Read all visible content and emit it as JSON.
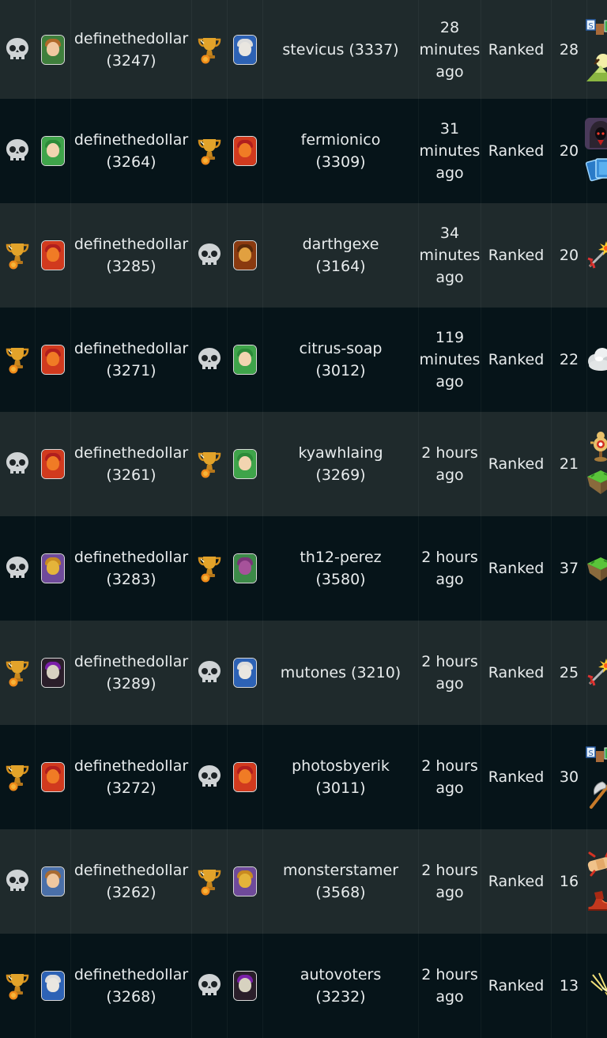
{
  "colors": {
    "row_light": "#1f2a2c",
    "row_dark": "#061419",
    "text": "#e8eced",
    "trophy_gold": "#e2a32a"
  },
  "battles": [
    {
      "player": {
        "result_icon": "skull-icon",
        "avatar": "avatar-young-man-green",
        "name": "definethedollar",
        "rating": "(3247)"
      },
      "opponent": {
        "result_icon": "trophy-icon",
        "avatar": "avatar-wizard-blue",
        "name": "stevicus (3337)",
        "rating": ""
      },
      "time": {
        "amount": "28",
        "unit": "minutes",
        "suffix": "ago"
      },
      "match_type": "Ranked",
      "mana": "28",
      "rulesets": [
        "standard-modern-icon",
        "moon-mountain-icon"
      ]
    },
    {
      "player": {
        "result_icon": "skull-icon",
        "avatar": "avatar-elf-green",
        "name": "definethedollar",
        "rating": "(3264)"
      },
      "opponent": {
        "result_icon": "trophy-icon",
        "avatar": "avatar-dragon-red",
        "name": "fermionico",
        "rating": "(3309)"
      },
      "time": {
        "amount": "31",
        "unit": "minutes",
        "suffix": "ago"
      },
      "match_type": "Ranked",
      "mana": "20",
      "rulesets": [
        "hooded-figure-icon",
        "cards-icon"
      ]
    },
    {
      "player": {
        "result_icon": "trophy-icon",
        "avatar": "avatar-dragon-red",
        "name": "definethedollar",
        "rating": "(3285)"
      },
      "opponent": {
        "result_icon": "skull-icon",
        "avatar": "avatar-warrior-orange",
        "name": "darthgexe",
        "rating": "(3164)"
      },
      "time": {
        "amount": "34",
        "unit": "minutes",
        "suffix": "ago"
      },
      "match_type": "Ranked",
      "mana": "20",
      "rulesets": [
        "explosive-arrow-icon"
      ]
    },
    {
      "player": {
        "result_icon": "trophy-icon",
        "avatar": "avatar-dragon-red",
        "name": "definethedollar",
        "rating": "(3271)"
      },
      "opponent": {
        "result_icon": "skull-icon",
        "avatar": "avatar-elf-green",
        "name": "citrus-soap",
        "rating": "(3012)"
      },
      "time": {
        "amount": "119",
        "unit": "minutes",
        "suffix": "ago"
      },
      "match_type": "Ranked",
      "mana": "22",
      "rulesets": [
        "cloud-icon"
      ]
    },
    {
      "player": {
        "result_icon": "skull-icon",
        "avatar": "avatar-dragon-red",
        "name": "definethedollar",
        "rating": "(3261)"
      },
      "opponent": {
        "result_icon": "trophy-icon",
        "avatar": "avatar-elf-green",
        "name": "kyawhlaing",
        "rating": "(3269)"
      },
      "time": {
        "amount": "2 hours",
        "unit": "ago",
        "suffix": ""
      },
      "match_type": "Ranked",
      "mana": "21",
      "rulesets": [
        "target-dummy-icon",
        "floating-island-icon"
      ]
    },
    {
      "player": {
        "result_icon": "skull-icon",
        "avatar": "avatar-gold-knight",
        "name": "definethedollar",
        "rating": "(3283)"
      },
      "opponent": {
        "result_icon": "trophy-icon",
        "avatar": "avatar-tentacle-purple",
        "name": "th12-perez",
        "rating": "(3580)"
      },
      "time": {
        "amount": "2 hours",
        "unit": "ago",
        "suffix": ""
      },
      "match_type": "Ranked",
      "mana": "37",
      "rulesets": [
        "floating-island-icon"
      ]
    },
    {
      "player": {
        "result_icon": "trophy-icon",
        "avatar": "avatar-dark-mage",
        "name": "definethedollar",
        "rating": "(3289)"
      },
      "opponent": {
        "result_icon": "skull-icon",
        "avatar": "avatar-wizard-blue",
        "name": "mutones (3210)",
        "rating": ""
      },
      "time": {
        "amount": "2 hours",
        "unit": "ago",
        "suffix": ""
      },
      "match_type": "Ranked",
      "mana": "25",
      "rulesets": [
        "explosive-arrow-icon"
      ]
    },
    {
      "player": {
        "result_icon": "trophy-icon",
        "avatar": "avatar-dragon-red",
        "name": "definethedollar",
        "rating": "(3272)"
      },
      "opponent": {
        "result_icon": "skull-icon",
        "avatar": "avatar-dragon-red",
        "name": "photosbyerik",
        "rating": "(3011)"
      },
      "time": {
        "amount": "2 hours",
        "unit": "ago",
        "suffix": ""
      },
      "match_type": "Ranked",
      "mana": "30",
      "rulesets": [
        "standard-modern-icon",
        "axe-icon"
      ]
    },
    {
      "player": {
        "result_icon": "skull-icon",
        "avatar": "avatar-young-man-blue",
        "name": "definethedollar",
        "rating": "(3262)"
      },
      "opponent": {
        "result_icon": "trophy-icon",
        "avatar": "avatar-gold-knight",
        "name": "monsterstamer",
        "rating": "(3568)"
      },
      "time": {
        "amount": "2 hours",
        "unit": "ago",
        "suffix": ""
      },
      "match_type": "Ranked",
      "mana": "16",
      "rulesets": [
        "bandage-icon",
        "red-boot-icon"
      ]
    },
    {
      "player": {
        "result_icon": "trophy-icon",
        "avatar": "avatar-wizard-blue",
        "name": "definethedollar",
        "rating": "(3268)"
      },
      "opponent": {
        "result_icon": "skull-icon",
        "avatar": "avatar-dark-mage",
        "name": "autovoters",
        "rating": "(3232)"
      },
      "time": {
        "amount": "2 hours",
        "unit": "ago",
        "suffix": ""
      },
      "match_type": "Ranked",
      "mana": "13",
      "rulesets": [
        "lightning-spark-icon"
      ]
    }
  ]
}
